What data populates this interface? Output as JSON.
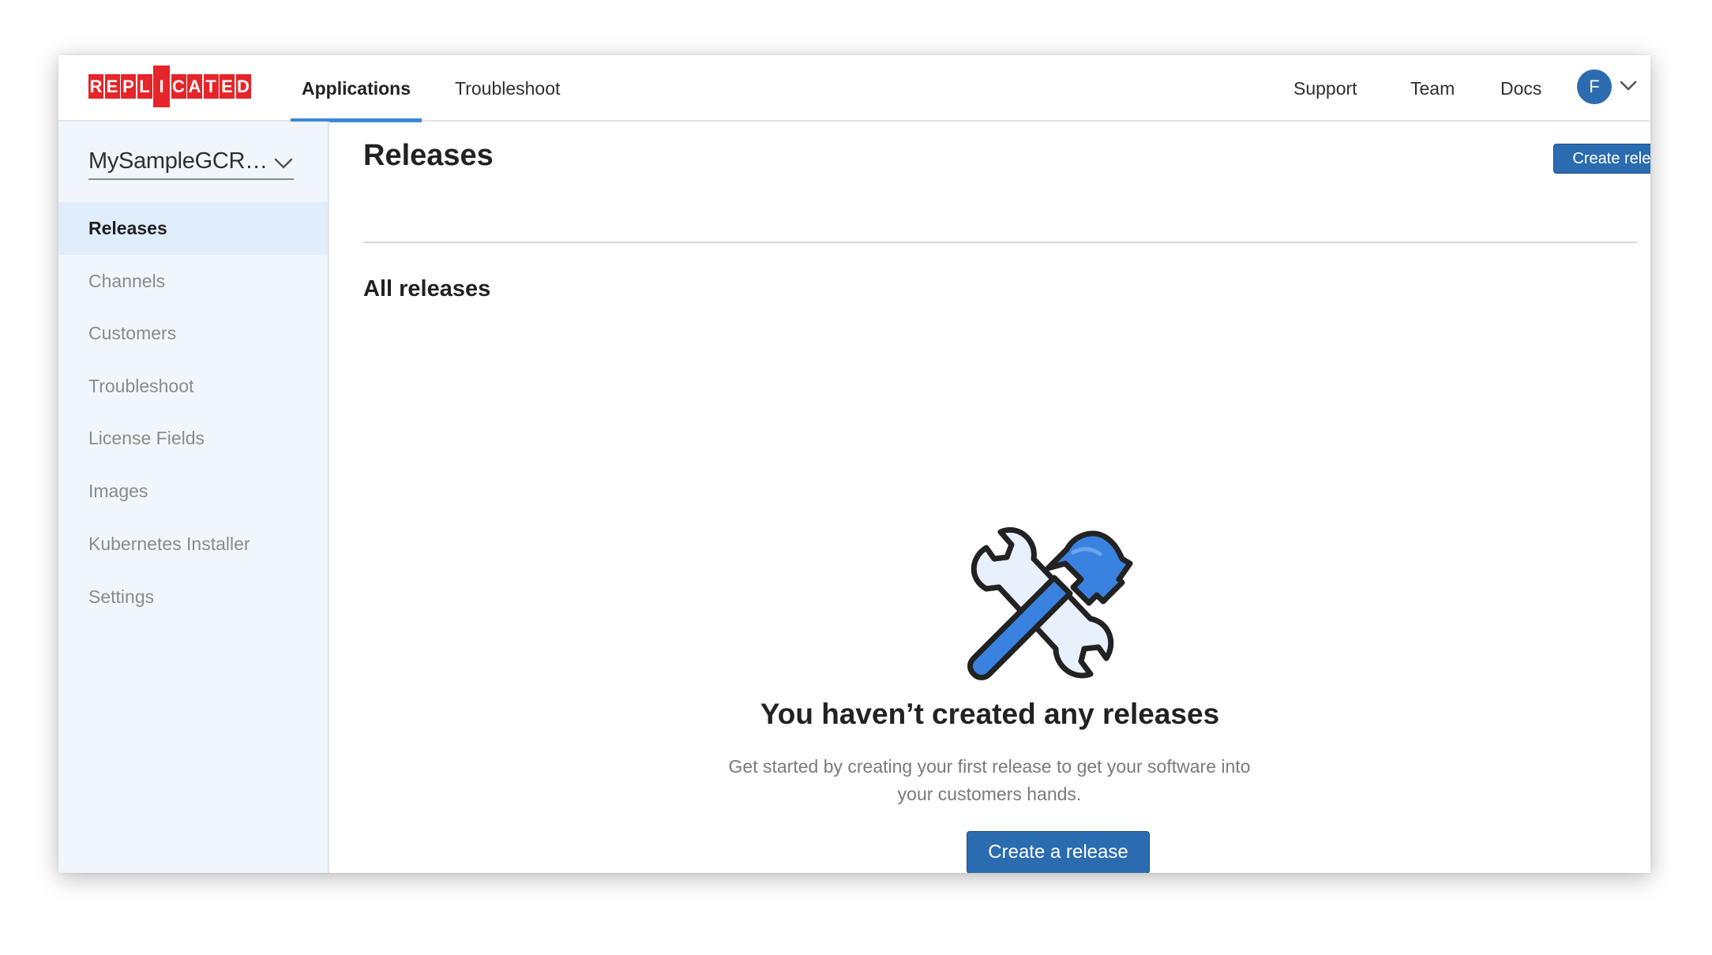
{
  "brand": {
    "logo_text": "REPLICATED",
    "accent": "#e5252a",
    "primary": "#2b6cb0"
  },
  "topnav": {
    "left": [
      {
        "label": "Applications",
        "active": true
      },
      {
        "label": "Troubleshoot",
        "active": false
      }
    ],
    "right": [
      {
        "label": "Support"
      },
      {
        "label": "Team"
      },
      {
        "label": "Docs"
      }
    ],
    "avatar_initial": "F",
    "avatar_menu_icon": "chevron-down-icon"
  },
  "sidebar": {
    "app_name": "MySampleGCR…",
    "app_select_icon": "chevron-down-icon",
    "items": [
      {
        "label": "Releases",
        "active": true
      },
      {
        "label": "Channels",
        "active": false
      },
      {
        "label": "Customers",
        "active": false
      },
      {
        "label": "Troubleshoot",
        "active": false
      },
      {
        "label": "License Fields",
        "active": false
      },
      {
        "label": "Images",
        "active": false
      },
      {
        "label": "Kubernetes Installer",
        "active": false
      },
      {
        "label": "Settings",
        "active": false
      }
    ]
  },
  "main": {
    "title": "Releases",
    "create_button": "Create release",
    "section_title": "All releases",
    "empty_state": {
      "icon": "tools-icon",
      "heading": "You haven’t created any releases",
      "description": "Get started by creating your first release to get your software into your customers hands.",
      "cta": "Create a release"
    }
  }
}
